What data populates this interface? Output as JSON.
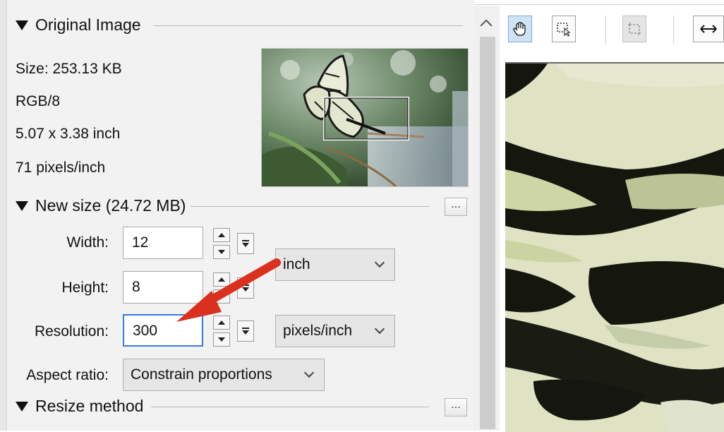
{
  "original_image": {
    "header": "Original Image",
    "size": "Size: 253.13 KB",
    "color_mode": "RGB/8",
    "dimensions": "5.07 x 3.38 inch",
    "resolution": "71 pixels/inch"
  },
  "new_size": {
    "header": "New size (24.72 MB)",
    "more_button": "...",
    "width_label": "Width:",
    "width_value": "12",
    "height_label": "Height:",
    "height_value": "8",
    "resolution_label": "Resolution:",
    "resolution_value": "300",
    "unit_select": "inch",
    "resolution_unit_select": "pixels/inch",
    "aspect_label": "Aspect ratio:",
    "aspect_select": "Constrain proportions"
  },
  "resize_method": {
    "header": "Resize method",
    "more_button": "..."
  },
  "toolbar": {
    "tools": [
      "hand-tool",
      "zoom-select-tool",
      "crop-tool",
      "fit-width-tool"
    ]
  },
  "colors": {
    "accent_focus": "#3a7bd5",
    "arrow": "#d9301f"
  }
}
